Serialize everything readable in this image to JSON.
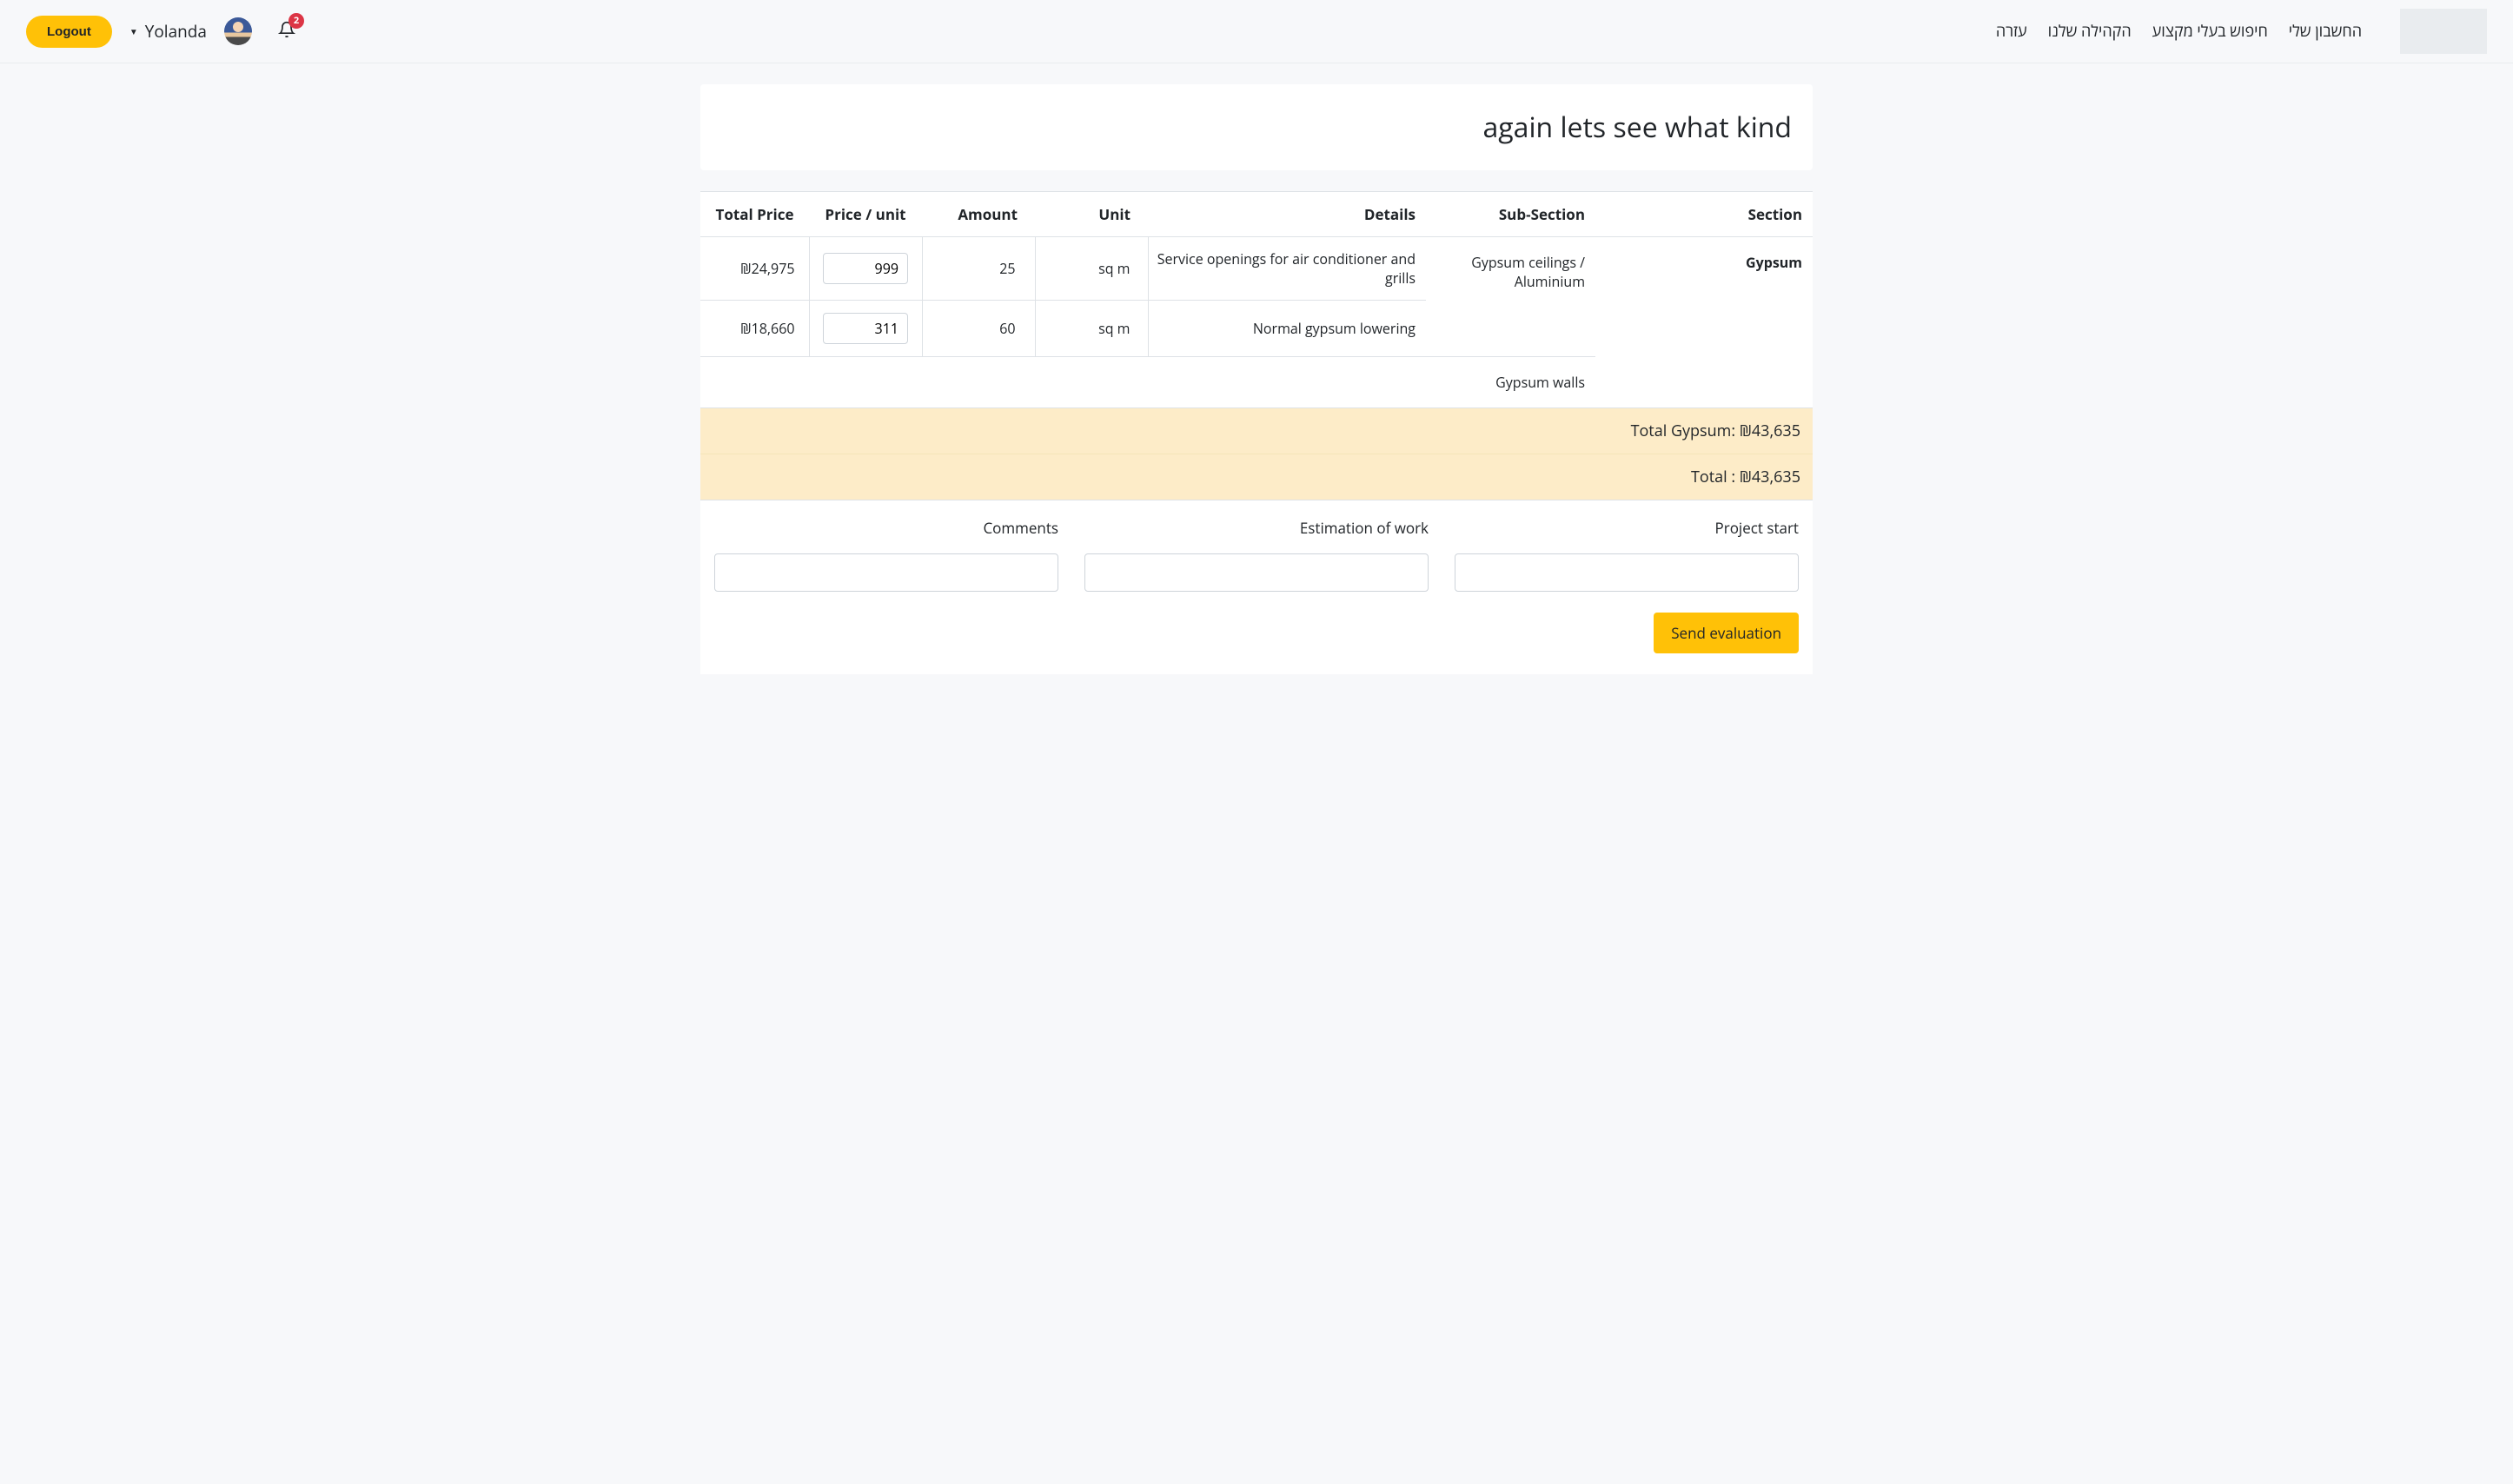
{
  "header": {
    "logout_label": "Logout",
    "username": "Yolanda",
    "notification_count": "2",
    "nav": [
      "עזרה",
      "הקהילה שלנו",
      "חיפוש בעלי מקצוע",
      "החשבון שלי"
    ]
  },
  "page_title": "again lets see what kind",
  "table": {
    "headers": {
      "total_price": "Total Price",
      "price_unit": "Price / unit",
      "amount": "Amount",
      "unit": "Unit",
      "details": "Details",
      "subsection": "Sub-Section",
      "section": "Section"
    },
    "section": "Gypsum",
    "subsection_1": "Gypsum ceilings / Aluminium",
    "subsection_2": "Gypsum walls",
    "rows": [
      {
        "total_price": "₪24,975",
        "price_unit": "999",
        "amount": "25",
        "unit": "sq m",
        "details": "Service openings for air conditioner and grills"
      },
      {
        "total_price": "₪18,660",
        "price_unit": "311",
        "amount": "60",
        "unit": "sq m",
        "details": "Normal gypsum lowering"
      }
    ],
    "subtotal": "Total Gypsum: ₪43,635",
    "grand_total": "Total : ₪43,635"
  },
  "form": {
    "comments_label": "Comments",
    "estimation_label": "Estimation of work",
    "project_start_label": "Project start",
    "submit_label": "Send evaluation"
  }
}
